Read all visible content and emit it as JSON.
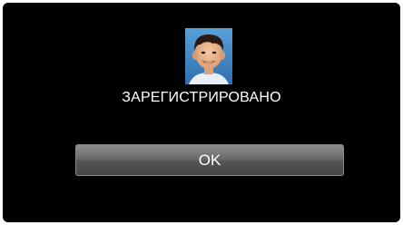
{
  "dialog": {
    "status_text": "ЗАРЕГИСТРИРОВАНО",
    "ok_label": "OK",
    "thumbnail_icon": "registered-face-photo"
  },
  "colors": {
    "screen_background": "#000000",
    "text": "#ffffff",
    "button_top": "#8e8e8e",
    "button_bottom": "#474747"
  }
}
